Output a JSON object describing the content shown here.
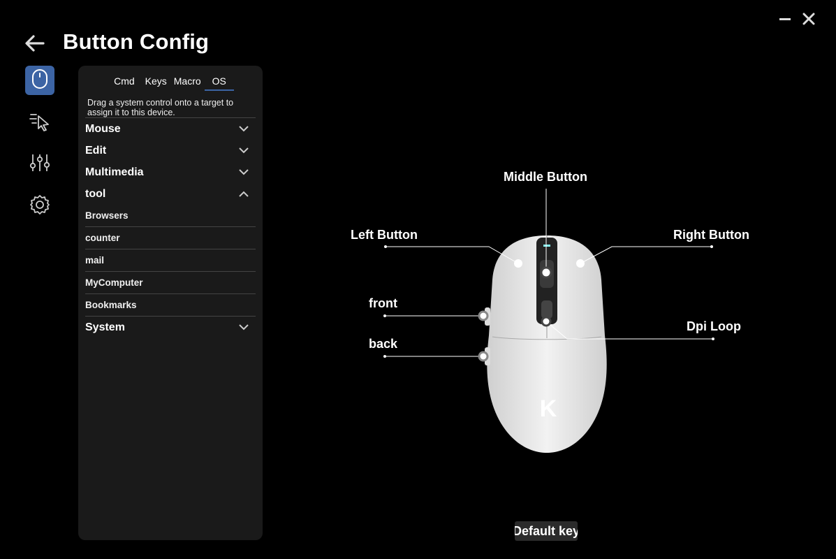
{
  "header": {
    "title": "Button Config"
  },
  "tabs": [
    {
      "label": "Cmd"
    },
    {
      "label": "Keys"
    },
    {
      "label": "Macro"
    },
    {
      "label": "OS"
    }
  ],
  "panel": {
    "hint": "Drag a system control onto a target to assign it to this device.",
    "categories": {
      "mouse": "Mouse",
      "edit": "Edit",
      "multimedia": "Multimedia",
      "tool": "tool",
      "system": "System"
    },
    "tool_items": [
      "Browsers",
      "counter",
      "mail",
      "MyComputer",
      "Bookmarks"
    ]
  },
  "mouse_buttons": {
    "middle": "Middle Button",
    "left": "Left Button",
    "right": "Right Button",
    "front": "front",
    "dpi": "Dpi Loop",
    "back": "back"
  },
  "logo_text": "K",
  "footer": {
    "default_key": "Default key"
  },
  "colors": {
    "accent": "#3c64a4",
    "panel": "#1a1a1a",
    "background": "#000000"
  }
}
